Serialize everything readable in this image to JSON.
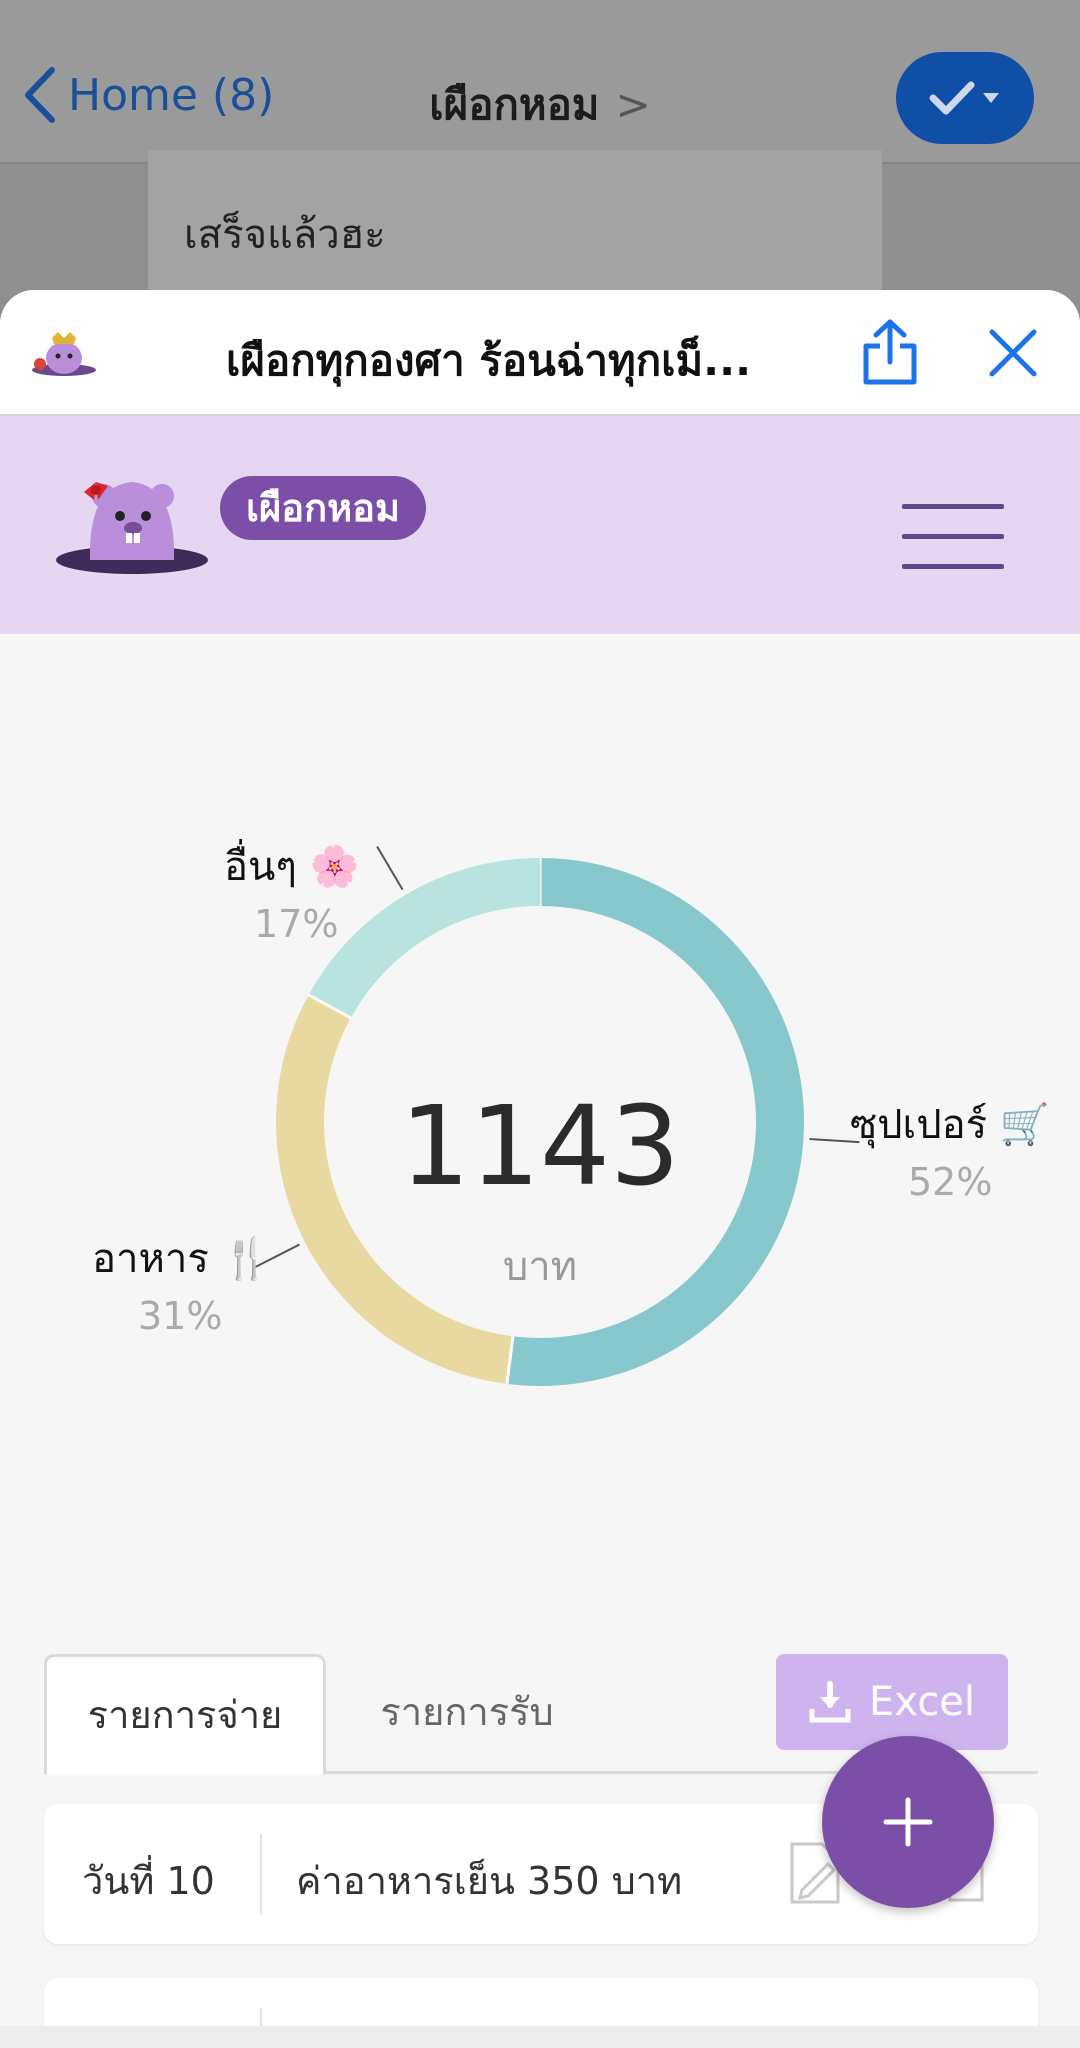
{
  "nav": {
    "back_label": "Home (8)",
    "title": "เผือกหอม",
    "title_chevron": ">"
  },
  "bubble": {
    "text": "เสร็จแล้วฮะ"
  },
  "sheet": {
    "title": "เผือกทุกองศา ร้อนฉ่าทุกเม็..."
  },
  "app": {
    "brand": "เผือกหอม"
  },
  "chart_data": {
    "type": "pie",
    "total": "1143",
    "unit": "บาท",
    "slices": [
      {
        "label": "ซุปเปอร์ 🛒",
        "percent_label": "52%",
        "value": 52,
        "color": "#86c8cc"
      },
      {
        "label": "อาหาร 🍴",
        "percent_label": "31%",
        "value": 31,
        "color": "#e7d9a0"
      },
      {
        "label": "อื่นๆ 🌸",
        "percent_label": "17%",
        "value": 17,
        "color": "#b9e3de"
      }
    ]
  },
  "tabs": {
    "expense": "รายการจ่าย",
    "income": "รายการรับ"
  },
  "excel": {
    "label": "Excel"
  },
  "entries": [
    {
      "day": "วันที่ 10",
      "description": "ค่าอาหารเย็น 350 บาท"
    }
  ],
  "colors": {
    "accent": "#7b4fa8",
    "header_bg": "#e5d6f2",
    "excel_bg": "#cdb4ee",
    "link": "#1a73e8"
  },
  "icons": [
    "chevron-left-icon",
    "check-icon",
    "share-icon",
    "close-icon",
    "hamburger-icon",
    "download-icon",
    "edit-icon",
    "delete-icon",
    "plus-icon",
    "mascot-logo"
  ]
}
